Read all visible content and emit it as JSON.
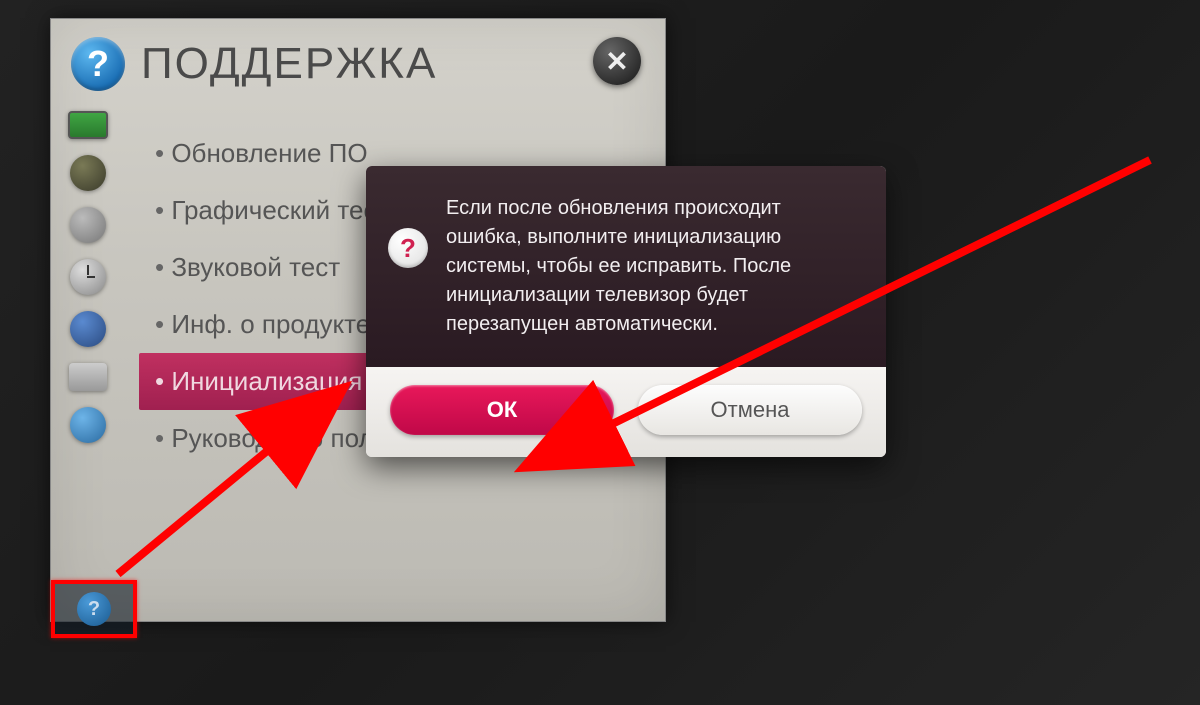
{
  "header": {
    "title": "ПОДДЕРЖКА"
  },
  "menu": {
    "items": [
      {
        "label": "Обновление ПО"
      },
      {
        "label": "Графический тест"
      },
      {
        "label": "Звуковой тест"
      },
      {
        "label": "Инф. о продукте"
      },
      {
        "label": "Инициализация",
        "selected": true
      },
      {
        "label": "Руководство пользователя"
      }
    ]
  },
  "dialog": {
    "message": "Если после обновления происходит ошибка, выполните инициализацию системы, чтобы ее исправить. После инициализации телевизор будет перезапущен автоматически.",
    "ok_label": "ОК",
    "cancel_label": "Отмена"
  },
  "sidebar_icons": [
    "tv-icon",
    "disc-icon",
    "satellite-icon",
    "clock-icon",
    "lock-icon",
    "box-icon",
    "globe-icon",
    "help-icon"
  ]
}
